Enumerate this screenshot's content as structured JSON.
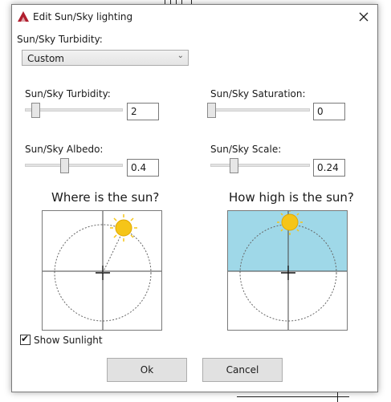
{
  "window": {
    "title": "Edit Sun/Sky lighting"
  },
  "preset": {
    "label": "Sun/Sky Turbidity:",
    "selected": "Custom"
  },
  "controls": {
    "turbidity": {
      "label": "Sun/Sky Turbidity:",
      "value": "2",
      "level": 0.12
    },
    "saturation": {
      "label": "Sun/Sky Saturation:",
      "value": "0",
      "level": 0.0
    },
    "albedo": {
      "label": "Sun/Sky Albedo:",
      "value": "0.4",
      "level": 0.4
    },
    "scale": {
      "label": "Sun/Sky Scale:",
      "value": "0.24",
      "level": 0.24
    }
  },
  "sun_direction": {
    "heading": "Where is the sun?"
  },
  "sun_height": {
    "heading": "How high is the sun?",
    "sky_color": "#9fd8e8"
  },
  "show_sunlight": {
    "label": "Show Sunlight",
    "checked": true
  },
  "buttons": {
    "ok": "Ok",
    "cancel": "Cancel"
  },
  "colors": {
    "sun": "#f5c518",
    "sky": "#9fd8e8",
    "app_icon": "#b01e2e"
  }
}
